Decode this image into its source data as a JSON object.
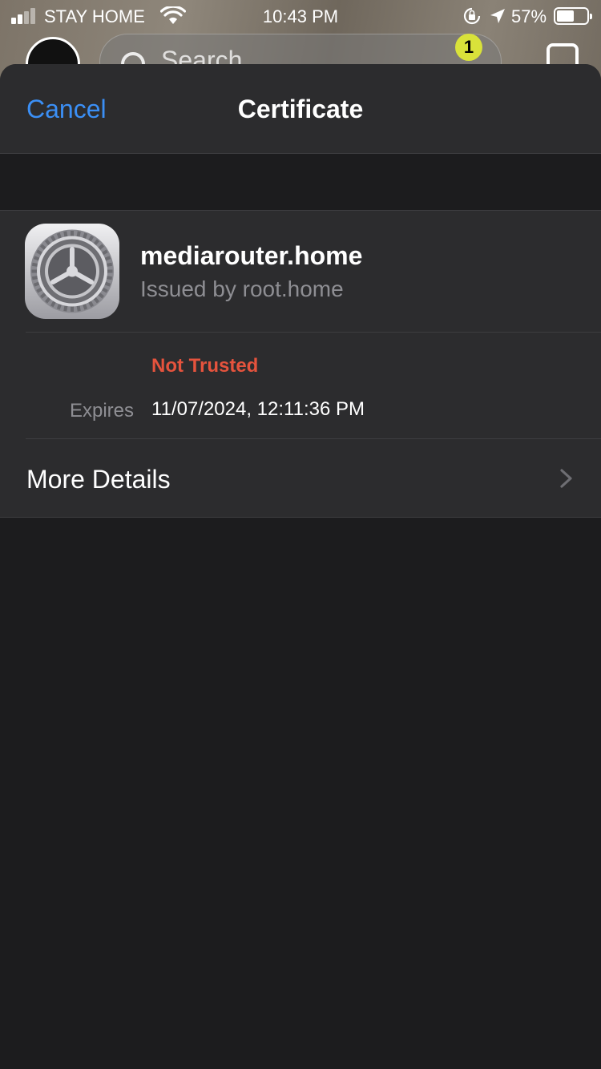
{
  "background_app": {
    "search_placeholder": "Search",
    "notification_badge": "1"
  },
  "status_bar": {
    "carrier": "STAY HOME",
    "time": "10:43 PM",
    "battery_percent": "57%",
    "battery_level": 0.57,
    "signal_bars": 2
  },
  "nav": {
    "cancel_label": "Cancel",
    "title": "Certificate"
  },
  "certificate": {
    "name": "mediarouter.home",
    "issuer": "Issued by root.home",
    "trust_status": "Not Trusted",
    "trust_color": "#e5533d",
    "expires_label": "Expires",
    "expires_value": "11/07/2024, 12:11:36 PM",
    "icon": "settings-gear-icon"
  },
  "details": {
    "label": "More Details"
  },
  "colors": {
    "accent": "#3b8ff5",
    "sheet_bg": "#1c1c1e",
    "group_bg": "#2c2c2e"
  }
}
